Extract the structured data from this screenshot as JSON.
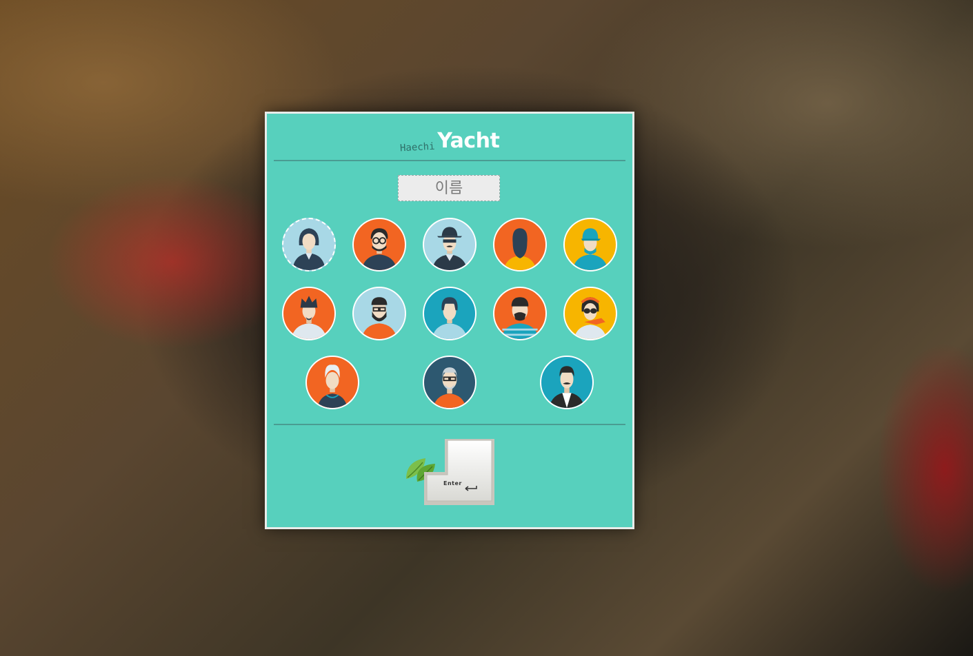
{
  "logo": {
    "small": "Haechi",
    "big": "Yacht"
  },
  "name_field": {
    "placeholder": "이름",
    "value": ""
  },
  "avatars": [
    {
      "id": "woman-dark-hair",
      "bg": "#a8d8e6",
      "selected": true
    },
    {
      "id": "man-glasses",
      "bg": "#f26522"
    },
    {
      "id": "man-hat-mustache",
      "bg": "#a8d8e6"
    },
    {
      "id": "faceless-man",
      "bg": "#f26522"
    },
    {
      "id": "person-cap",
      "bg": "#f7b500"
    },
    {
      "id": "man-spiky-hair",
      "bg": "#f26522"
    },
    {
      "id": "man-beard-glasses",
      "bg": "#a8d8e6"
    },
    {
      "id": "man-bowl-hair",
      "bg": "#1ba4bd"
    },
    {
      "id": "man-mustache-striped",
      "bg": "#f26522"
    },
    {
      "id": "woman-sunglasses-scarf",
      "bg": "#f7b500"
    },
    {
      "id": "old-woman",
      "bg": "#f26522"
    },
    {
      "id": "old-man-glasses",
      "bg": "#2d5870"
    },
    {
      "id": "man-suit-mustache",
      "bg": "#1ba4bd"
    }
  ],
  "enter_key": {
    "label": "Enter"
  },
  "colors": {
    "panel": "#57d0bd",
    "orange": "#f26522",
    "yellow": "#f7b500",
    "lightblue": "#a8d8e6",
    "teal": "#1ba4bd",
    "navy": "#2d5870"
  }
}
